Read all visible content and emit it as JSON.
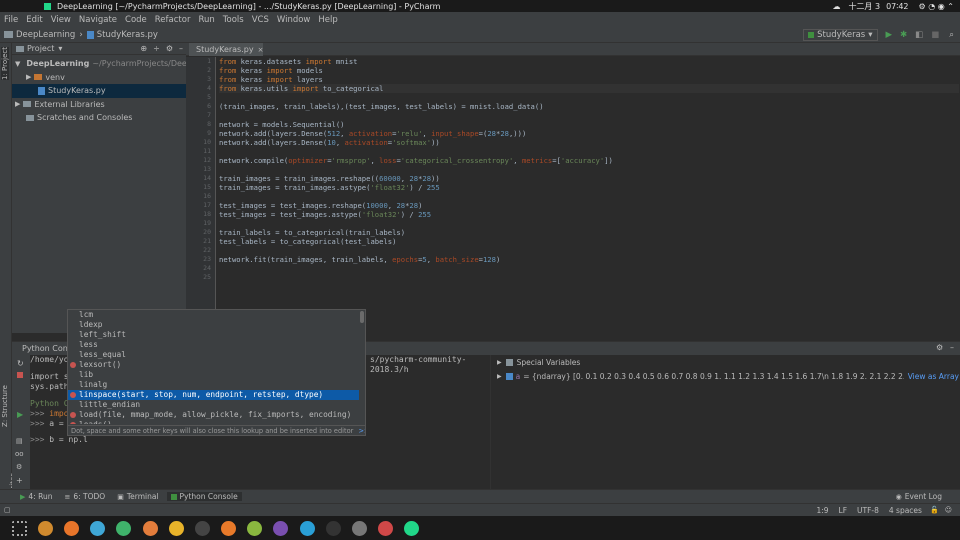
{
  "topbar": {
    "window_title": "DeepLearning [~/PycharmProjects/DeepLearning] - .../StudyKeras.py [DeepLearning] - PyCharm",
    "date": "十二月 3",
    "time": "07∶42"
  },
  "menubar": {
    "items": [
      "File",
      "Edit",
      "View",
      "Navigate",
      "Code",
      "Refactor",
      "Run",
      "Tools",
      "VCS",
      "Window",
      "Help"
    ]
  },
  "navbar": {
    "project": "DeepLearning",
    "file": "StudyKeras.py",
    "run_config": "StudyKeras"
  },
  "sidestrip": {
    "project_label": "1: Project",
    "structure_label": "Z: Structure",
    "favorites_label": "2: Favorites"
  },
  "project_pane": {
    "title": "Project",
    "items": [
      {
        "label": "DeepLearning",
        "path": "~/PycharmProjects/DeepLear..."
      },
      {
        "label": "venv"
      },
      {
        "label": "StudyKeras.py"
      },
      {
        "label": "External Libraries"
      },
      {
        "label": "Scratches and Consoles"
      }
    ]
  },
  "editor": {
    "tab": "StudyKeras.py",
    "line_numbers": [
      "1",
      "2",
      "3",
      "4",
      "5",
      "6",
      "7",
      "8",
      "9",
      "10",
      "11",
      "12",
      "13",
      "14",
      "15",
      "16",
      "17",
      "18",
      "19",
      "20",
      "21",
      "22",
      "23",
      "24",
      "25"
    ],
    "lines": [
      "from keras.datasets import mnist",
      "from keras import models",
      "from keras import layers",
      "from keras.utils import to_categorical",
      "",
      "(train_images, train_labels),(test_images, test_labels) = mnist.load_data()",
      "",
      "network = models.Sequential()",
      "network.add(layers.Dense(512, activation='relu', input_shape=(28*28,)))",
      "network.add(layers.Dense(10, activation='softmax'))",
      "",
      "network.compile(optimizer='rmsprop', loss='categorical_crossentropy', metrics=['accuracy'])",
      "",
      "train_images = train_images.reshape((60000, 28*28))",
      "train_images = train_images.astype('float32') / 255",
      "",
      "test_images = test_images.reshape(10000, 28*28)",
      "test_images = test_images.astype('float32') / 255",
      "",
      "train_labels = to_categorical(train_labels)",
      "test_labels = to_categorical(test_labels)",
      "",
      "network.fit(train_images, train_labels, epochs=5, batch_size=128)",
      "",
      ""
    ]
  },
  "console": {
    "title": "Python Console",
    "line1": "/home/you",
    "line1_tail": "s/pycharm-community-2018.3/h",
    "line2": "import sy",
    "line3": "sys.path.",
    "line4": "Python Co",
    "line5": "impor",
    "line6": "a = n",
    "line7": "b = np.l",
    "prompt": ">>>"
  },
  "variables": {
    "special": "Special Variables",
    "var_name": "a",
    "var_value": "= {ndarray} [0.  0.1 0.2 0.3 0.4 0.5 0.6 0.7 0.8 0.9 1.  1.1 1.2 1.3 1.4 1.5 1.6 1.7\\n 1.8 1.9 2.  2.1 2.2 2.3 2.4 2.5 2.6 2.7 2.8 2.9 ...",
    "view_link": "View as Array"
  },
  "autocomplete": {
    "items": [
      "lcm",
      "ldexp",
      "left_shift",
      "less",
      "less_equal",
      "lexsort()",
      "lib",
      "linalg",
      "linspace(start, stop, num, endpoint, retstep, dtype)",
      "little_endian",
      "load(file, mmap_mode, allow_pickle, fix_imports, encoding)",
      "loads()"
    ],
    "selected_index": 8,
    "func_items": [
      5,
      8,
      10,
      11
    ],
    "hint": "Dot, space and some other keys will also close this lookup and be inserted into editor",
    "hint_link": ">>"
  },
  "toolwindows": [
    "4: Run",
    "6: TODO",
    "Terminal",
    "Python Console"
  ],
  "event_log": "Event Log",
  "status": {
    "position": "1:9",
    "line_sep": "LF",
    "encoding": "UTF-8",
    "indent": "4 spaces"
  },
  "colors": {
    "accent": "#0d5aa7",
    "keyword": "#cc7832",
    "string": "#6a8759",
    "number": "#6897bb"
  },
  "dock_icons": [
    "grid-icon",
    "folder-icon",
    "firefox-icon",
    "store-icon",
    "files-icon",
    "image-icon",
    "settings-icon",
    "terminal-icon",
    "app-icon",
    "app2-icon",
    "text-icon",
    "app3-icon",
    "clock-icon",
    "game-icon",
    "deepin-icon",
    "pycharm-icon"
  ]
}
